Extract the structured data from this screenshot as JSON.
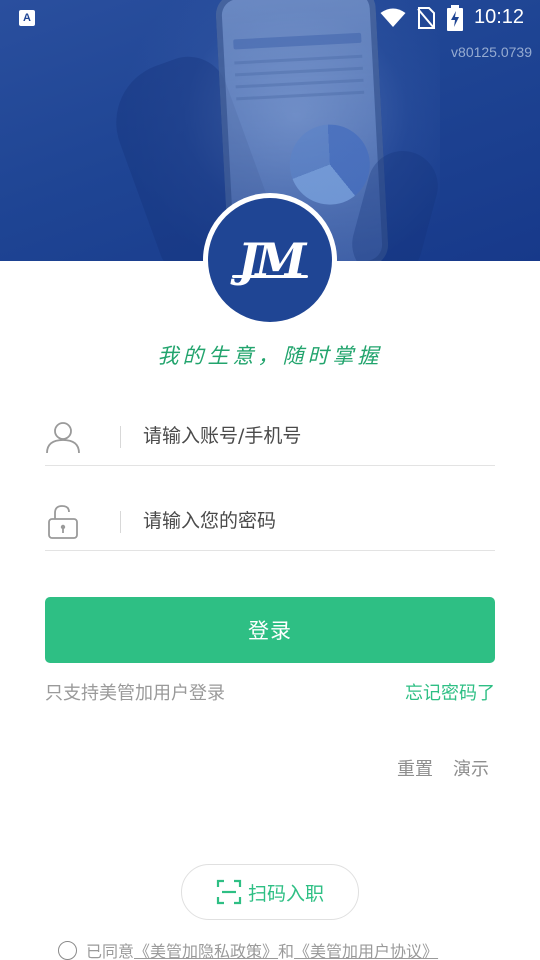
{
  "status_bar": {
    "time": "10:12",
    "notification_icon": "A",
    "icons": [
      "text-notification-icon",
      "wifi-icon",
      "no-sim-icon",
      "battery-charging-icon"
    ]
  },
  "header": {
    "version": "v80125.0739",
    "logo_text": "JM",
    "slogan": "我的生意，随时掌握"
  },
  "form": {
    "account_placeholder": "请输入账号/手机号",
    "password_placeholder": "请输入您的密码",
    "account_icon": "user-icon",
    "password_icon": "unlock-icon"
  },
  "actions": {
    "login_label": "登录",
    "support_hint": "只支持美管加用户登录",
    "forgot_password": "忘记密码了",
    "reset": "重置",
    "demo": "演示",
    "scan_label": "扫码入职",
    "scan_icon": "scan-icon"
  },
  "agreement": {
    "prefix": "已同意",
    "privacy_link": "《美管加隐私政策》",
    "conjunction": "和",
    "user_link": "《美管加用户协议》"
  },
  "colors": {
    "brand_blue": "#1f4594",
    "accent_green": "#2ebf84",
    "slogan_green": "#22a46d"
  }
}
